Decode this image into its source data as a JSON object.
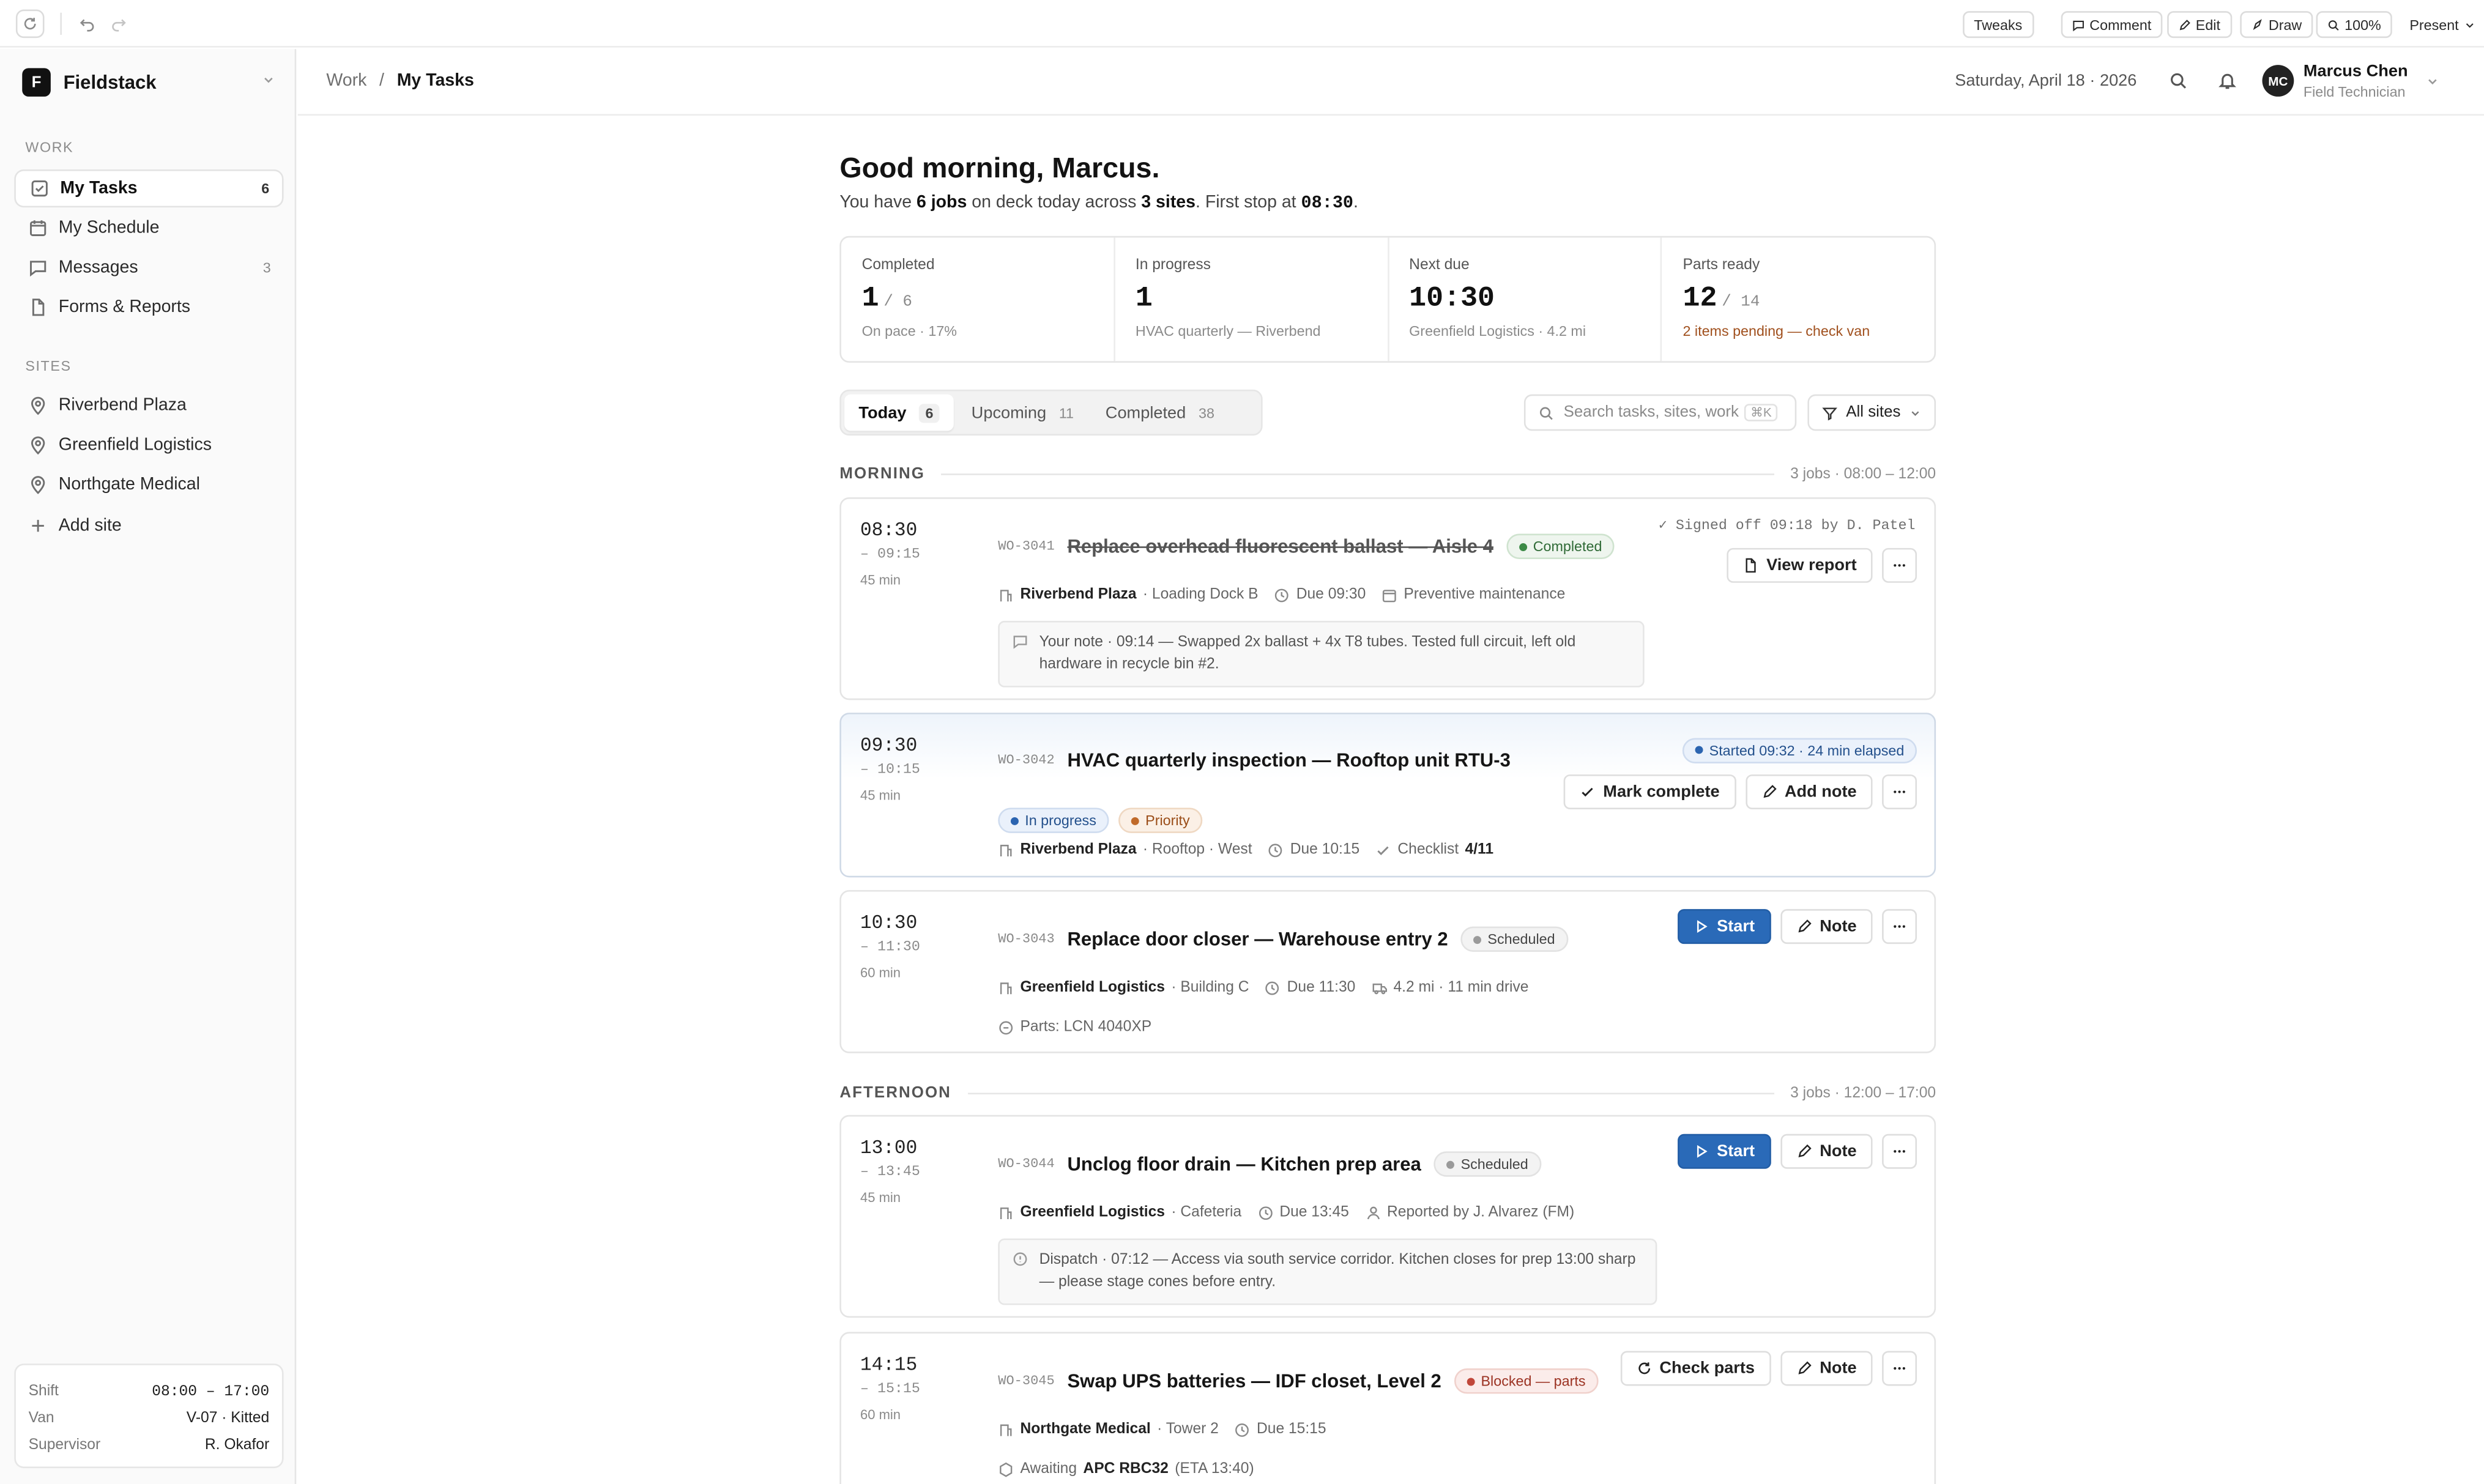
{
  "toolbar": {
    "tweaks": "Tweaks",
    "comment": "Comment",
    "edit": "Edit",
    "draw": "Draw",
    "zoom": "100%",
    "present": "Present"
  },
  "workspace": {
    "logo": "F",
    "name": "Fieldstack"
  },
  "sidebar": {
    "work_label": "WORK",
    "nav": [
      {
        "label": "My Tasks",
        "count": "6",
        "icon": "checkbox-icon"
      },
      {
        "label": "My Schedule",
        "count": "",
        "icon": "calendar-icon"
      },
      {
        "label": "Messages",
        "count": "3",
        "icon": "chat-icon"
      },
      {
        "label": "Forms & Reports",
        "count": "",
        "icon": "document-icon"
      }
    ],
    "sites_label": "SITES",
    "sites": [
      {
        "label": "Riverbend Plaza"
      },
      {
        "label": "Greenfield Logistics"
      },
      {
        "label": "Northgate Medical"
      }
    ],
    "add_site": "Add site",
    "shift": {
      "shift_label": "Shift",
      "shift_value": "08:00 – 17:00",
      "van_label": "Van",
      "van_value": "V-07 · Kitted",
      "supervisor_label": "Supervisor",
      "supervisor_value": "R. Okafor"
    }
  },
  "header": {
    "crumb_parent": "Work",
    "crumb_sep": "/",
    "crumb_current": "My Tasks",
    "date": "Saturday, April 18 · 2026",
    "user_initials": "MC",
    "user_name": "Marcus Chen",
    "user_role": "Field Technician"
  },
  "greeting": {
    "title": "Good morning, Marcus.",
    "pre": "You have ",
    "jobs": "6 jobs",
    "mid": " on deck today across ",
    "sites": "3 sites",
    "mid2": ". First stop at ",
    "first": "08:30",
    "end": "."
  },
  "stats": [
    {
      "label": "Completed",
      "value": "1",
      "denom": "/ 6",
      "note": "On pace · 17%"
    },
    {
      "label": "In progress",
      "value": "1",
      "denom": "",
      "note": "HVAC quarterly — Riverbend"
    },
    {
      "label": "Next due",
      "value": "10:30",
      "denom": "",
      "note": "Greenfield Logistics · 4.2 mi"
    },
    {
      "label": "Parts ready",
      "value": "12",
      "denom": "/ 14",
      "note": "2 items pending — check van"
    }
  ],
  "tabs": [
    {
      "label": "Today",
      "count": "6"
    },
    {
      "label": "Upcoming",
      "count": "11"
    },
    {
      "label": "Completed",
      "count": "38"
    }
  ],
  "search": {
    "placeholder": "Search tasks, sites, work orders",
    "kbd": "⌘K"
  },
  "filter": {
    "label": "All sites"
  },
  "sections": {
    "morning": {
      "name": "MORNING",
      "meta": "3 jobs · 08:00 – 12:00"
    },
    "afternoon": {
      "name": "AFTERNOON",
      "meta": "3 jobs · 12:00 – 17:00"
    }
  },
  "jobs": [
    {
      "start": "08:30",
      "end": "– 09:15",
      "duration": "45 min",
      "id": "WO-3041",
      "title": "Replace overhead fluorescent ballast — Aisle 4",
      "status": "Completed",
      "site": "Riverbend Plaza",
      "location": "· Loading Dock B",
      "due": "Due 09:30",
      "extra": "Preventive maintenance",
      "signed": "✓ Signed off 09:18 by D. Patel",
      "action": "View report",
      "note": "Your note · 09:14 — Swapped 2x ballast + 4x T8 tubes. Tested full circuit, left old hardware in recycle bin #2."
    },
    {
      "start": "09:30",
      "end": "– 10:15",
      "duration": "45 min",
      "id": "WO-3042",
      "title": "HVAC quarterly inspection — Rooftop unit RTU-3",
      "status": "In progress",
      "priority": "Priority",
      "started": "Started 09:32 · 24 min elapsed",
      "site": "Riverbend Plaza",
      "location": "· Rooftop · West",
      "due": "Due 10:15",
      "checklist_label": "Checklist",
      "checklist_value": "4/11",
      "action_primary": "Mark complete",
      "action_secondary": "Add note"
    },
    {
      "start": "10:30",
      "end": "– 11:30",
      "duration": "60 min",
      "id": "WO-3043",
      "title": "Replace door closer — Warehouse entry 2",
      "status": "Scheduled",
      "site": "Greenfield Logistics",
      "location": "· Building C",
      "due": "Due 11:30",
      "extra": "4.2 mi · 11 min drive",
      "parts": "Parts: LCN 4040XP",
      "action_primary": "Start",
      "action_secondary": "Note"
    },
    {
      "start": "13:00",
      "end": "– 13:45",
      "duration": "45 min",
      "id": "WO-3044",
      "title": "Unclog floor drain — Kitchen prep area",
      "status": "Scheduled",
      "site": "Greenfield Logistics",
      "location": "· Cafeteria",
      "due": "Due 13:45",
      "extra": "Reported by J. Alvarez (FM)",
      "note": "Dispatch · 07:12 — Access via south service corridor. Kitchen closes for prep 13:00 sharp — please stage cones before entry.",
      "action_primary": "Start",
      "action_secondary": "Note"
    },
    {
      "start": "14:15",
      "end": "– 15:15",
      "duration": "60 min",
      "id": "WO-3045",
      "title": "Swap UPS batteries — IDF closet, Level 2",
      "status": "Blocked — parts",
      "site": "Northgate Medical",
      "location": "· Tower 2",
      "due": "Due 15:15",
      "awaiting_label": "Awaiting",
      "awaiting_part": "APC RBC32",
      "awaiting_eta": "(ETA 13:40)",
      "action_primary": "Check parts",
      "action_secondary": "Note"
    }
  ],
  "colors": {
    "primary": "#2a6ab8",
    "success": "#3c8a46",
    "warning": "#c06a2a",
    "danger": "#c0473a"
  }
}
